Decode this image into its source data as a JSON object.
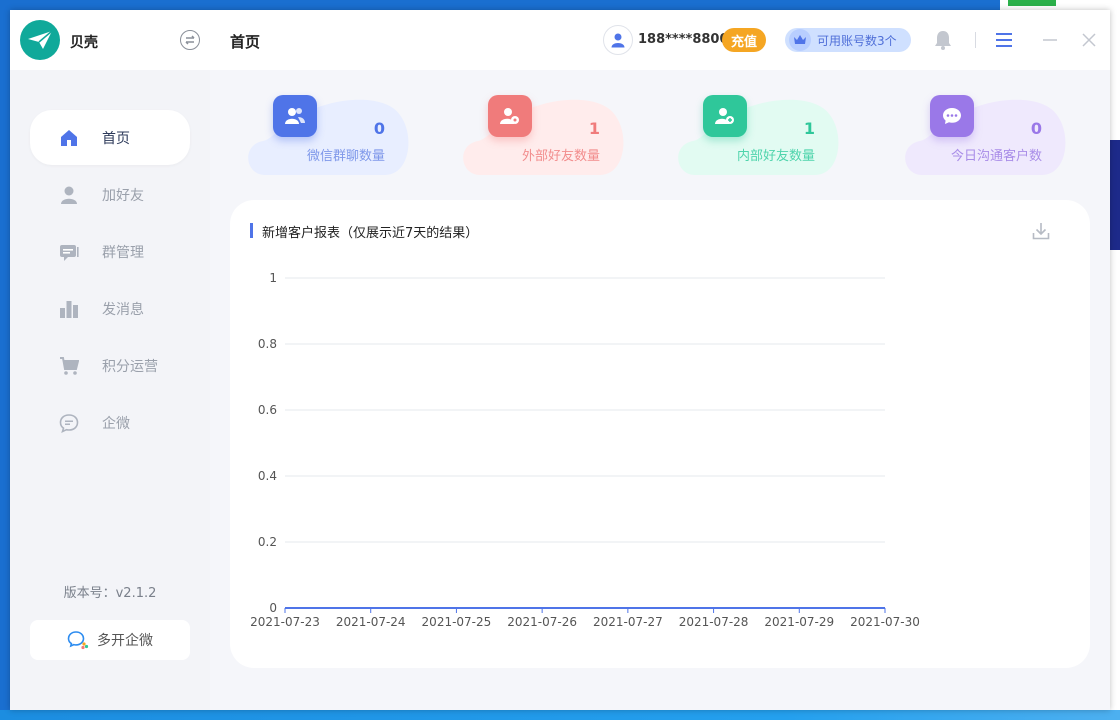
{
  "app": {
    "name": "贝壳",
    "version": "版本号：v2.1.2"
  },
  "sidebar": {
    "items": [
      {
        "label": "首页",
        "icon": "home-icon",
        "active": true
      },
      {
        "label": "加好友",
        "icon": "user-icon",
        "active": false
      },
      {
        "label": "群管理",
        "icon": "group-chat-icon",
        "active": false
      },
      {
        "label": "发消息",
        "icon": "bar-chart-icon",
        "active": false
      },
      {
        "label": "积分运营",
        "icon": "cart-icon",
        "active": false
      },
      {
        "label": "企微",
        "icon": "chat-bubble-icon",
        "active": false
      }
    ],
    "multi_open_label": "多开企微"
  },
  "header": {
    "title": "首页",
    "phone": "188****8800",
    "recharge_label": "充值",
    "accounts_label": "可用账号数3个"
  },
  "stats": [
    {
      "value": "0",
      "label": "微信群聊数量",
      "color": "#4f74e8",
      "bg": "#e8eeff",
      "icon": "group-users-icon"
    },
    {
      "value": "1",
      "label": "外部好友数量",
      "color": "#f07b7b",
      "bg": "#ffecec",
      "icon": "external-friend-icon"
    },
    {
      "value": "1",
      "label": "内部好友数量",
      "color": "#2fc79a",
      "bg": "#e2fbf2",
      "icon": "internal-friend-icon"
    },
    {
      "value": "0",
      "label": "今日沟通客户数",
      "color": "#9a78e8",
      "bg": "#efe9fd",
      "icon": "message-icon"
    }
  ],
  "report": {
    "title": "新增客户报表（仅展示近7天的结果）"
  },
  "chart_data": {
    "type": "line",
    "title": "新增客户报表（仅展示近7天的结果）",
    "xlabel": "",
    "ylabel": "",
    "x": [
      "2021-07-23",
      "2021-07-24",
      "2021-07-25",
      "2021-07-26",
      "2021-07-27",
      "2021-07-28",
      "2021-07-29",
      "2021-07-30"
    ],
    "series": [
      {
        "values": [
          0,
          0,
          0,
          0,
          0,
          0,
          0,
          0
        ],
        "color": "#4f74e8"
      }
    ],
    "yticks": [
      "0",
      "0.2",
      "0.4",
      "0.6",
      "0.8",
      "1"
    ],
    "ylim": [
      0,
      1
    ],
    "grid": true
  },
  "colors": {
    "accent": "#4f74e8",
    "recharge": "#f5a623",
    "logo": "#10a99a"
  }
}
